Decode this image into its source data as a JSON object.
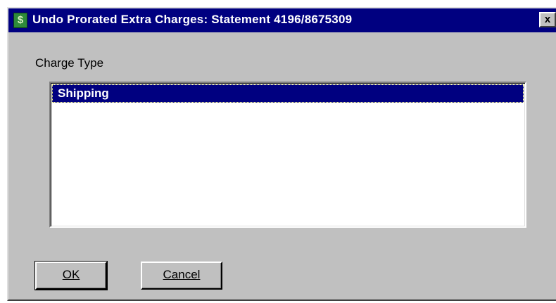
{
  "window": {
    "title": "Undo Prorated Extra Charges: Statement 4196/8675309",
    "icon_glyph": "$",
    "icon_name": "dollar-app-icon",
    "close_label": "x"
  },
  "form": {
    "charge_type_label": "Charge Type",
    "charge_types": [
      "Shipping"
    ],
    "selected_index": 0
  },
  "buttons": {
    "ok_label": "OK",
    "cancel_label": "Cancel"
  },
  "colors": {
    "titlebar": "#000080",
    "face": "#c0c0c0",
    "selection": "#000080"
  }
}
